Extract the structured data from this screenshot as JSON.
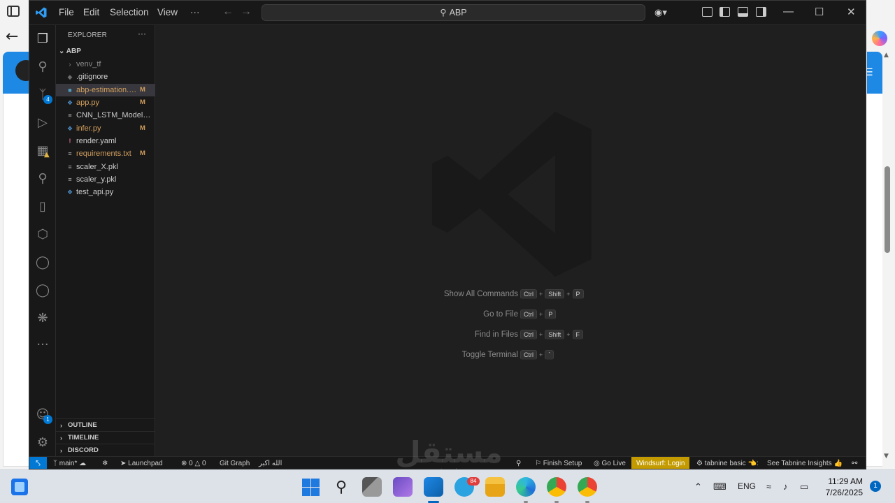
{
  "vscode": {
    "menu": [
      "File",
      "Edit",
      "Selection",
      "View",
      "···"
    ],
    "search_text": "ABP",
    "explorer": {
      "title": "EXPLORER",
      "more": "···",
      "root": "ABP",
      "files": [
        {
          "name": "venv_tf",
          "kind": "folder",
          "status": ""
        },
        {
          "name": ".gitignore",
          "kind": "git",
          "status": ""
        },
        {
          "name": "abp-estimation.ipynb",
          "kind": "notebook",
          "status": "M"
        },
        {
          "name": "app.py",
          "kind": "python",
          "status": "M"
        },
        {
          "name": "CNN_LSTM_Model_2...",
          "kind": "file",
          "status": ""
        },
        {
          "name": "infer.py",
          "kind": "python",
          "status": "M"
        },
        {
          "name": "render.yaml",
          "kind": "yaml",
          "status": ""
        },
        {
          "name": "requirements.txt",
          "kind": "file",
          "status": "M"
        },
        {
          "name": "scaler_X.pkl",
          "kind": "file",
          "status": ""
        },
        {
          "name": "scaler_y.pkl",
          "kind": "file",
          "status": ""
        },
        {
          "name": "test_api.py",
          "kind": "python",
          "status": ""
        }
      ],
      "sections": [
        "OUTLINE",
        "TIMELINE",
        "DISCORD"
      ]
    },
    "activity_badges": {
      "scm": "4",
      "accounts": "1"
    },
    "shortcuts": [
      {
        "label": "Show All Commands",
        "keys": [
          "Ctrl",
          "Shift",
          "P"
        ]
      },
      {
        "label": "Go to File",
        "keys": [
          "Ctrl",
          "P"
        ]
      },
      {
        "label": "Find in Files",
        "keys": [
          "Ctrl",
          "Shift",
          "F"
        ]
      },
      {
        "label": "Toggle Terminal",
        "keys": [
          "Ctrl",
          "`"
        ]
      }
    ],
    "status": {
      "branch": "main*",
      "launchpad": "Launchpad",
      "errors": "0",
      "warnings": "0",
      "git_graph": "Git Graph",
      "arabic": "الله اكبر",
      "finish_setup": "Finish Setup",
      "go_live": "Go Live",
      "windsurf": "Windsurf: Login",
      "tabnine": "tabnine basic 👈:",
      "tabnine_insights": "See Tabnine Insights 👍"
    }
  },
  "taskbar": {
    "language": "ENG",
    "time": "11:29 AM",
    "date": "7/26/2025",
    "notification_count": "1",
    "telegram_badge": "84"
  },
  "colors": {
    "accent": "#0078d4",
    "windsurf": "#c39b00",
    "modified": "#d39f5e"
  }
}
